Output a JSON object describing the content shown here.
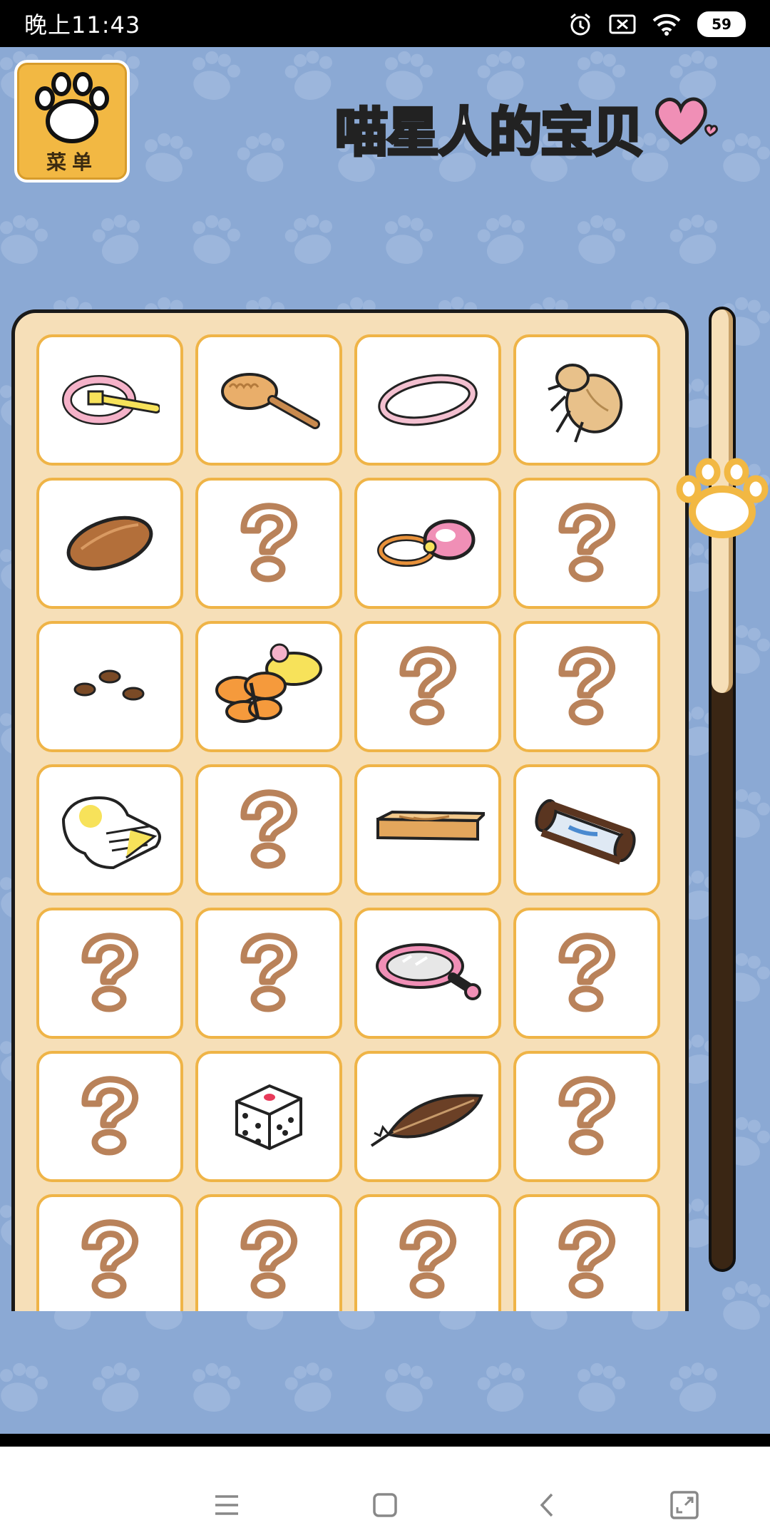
{
  "status_bar": {
    "time": "晚上11:43",
    "battery": "59",
    "icons": [
      "alarm-icon",
      "sim-off-icon",
      "wifi-icon",
      "battery-icon"
    ]
  },
  "header": {
    "menu_label": "菜单",
    "title": "喵星人的宝贝"
  },
  "collection": {
    "items": [
      {
        "name": "pink-collar-icon",
        "unlocked": true
      },
      {
        "name": "brush-icon",
        "unlocked": true
      },
      {
        "name": "pink-ring-icon",
        "unlocked": true
      },
      {
        "name": "cicada-shell-icon",
        "unlocked": true
      },
      {
        "name": "acorn-icon",
        "unlocked": true
      },
      {
        "name": "question-mark-icon",
        "unlocked": false
      },
      {
        "name": "pink-hair-tie-icon",
        "unlocked": true
      },
      {
        "name": "question-mark-icon",
        "unlocked": false
      },
      {
        "name": "seeds-icon",
        "unlocked": true
      },
      {
        "name": "butterfly-toy-icon",
        "unlocked": true
      },
      {
        "name": "question-mark-icon",
        "unlocked": false
      },
      {
        "name": "question-mark-icon",
        "unlocked": false
      },
      {
        "name": "glove-icon",
        "unlocked": true
      },
      {
        "name": "question-mark-icon",
        "unlocked": false
      },
      {
        "name": "wood-plank-icon",
        "unlocked": true
      },
      {
        "name": "hourglass-icon",
        "unlocked": true
      },
      {
        "name": "question-mark-icon",
        "unlocked": false
      },
      {
        "name": "question-mark-icon",
        "unlocked": false
      },
      {
        "name": "hand-mirror-icon",
        "unlocked": true
      },
      {
        "name": "question-mark-icon",
        "unlocked": false
      },
      {
        "name": "question-mark-icon",
        "unlocked": false
      },
      {
        "name": "dice-icon",
        "unlocked": true
      },
      {
        "name": "feather-icon",
        "unlocked": true
      },
      {
        "name": "question-mark-icon",
        "unlocked": false
      },
      {
        "name": "question-mark-icon",
        "unlocked": false
      },
      {
        "name": "question-mark-icon",
        "unlocked": false
      },
      {
        "name": "question-mark-icon",
        "unlocked": false
      },
      {
        "name": "question-mark-icon",
        "unlocked": false
      }
    ],
    "scroll_progress": 0.4
  },
  "nav_bar": {
    "buttons": [
      "menu-icon",
      "home-icon",
      "back-icon",
      "screenshot-icon"
    ]
  },
  "colors": {
    "background": "#8ba9d4",
    "panel": "#f6dfb8",
    "cell_border": "#efb447",
    "menu_button": "#f2b843",
    "question_mark": "#b9825a"
  }
}
